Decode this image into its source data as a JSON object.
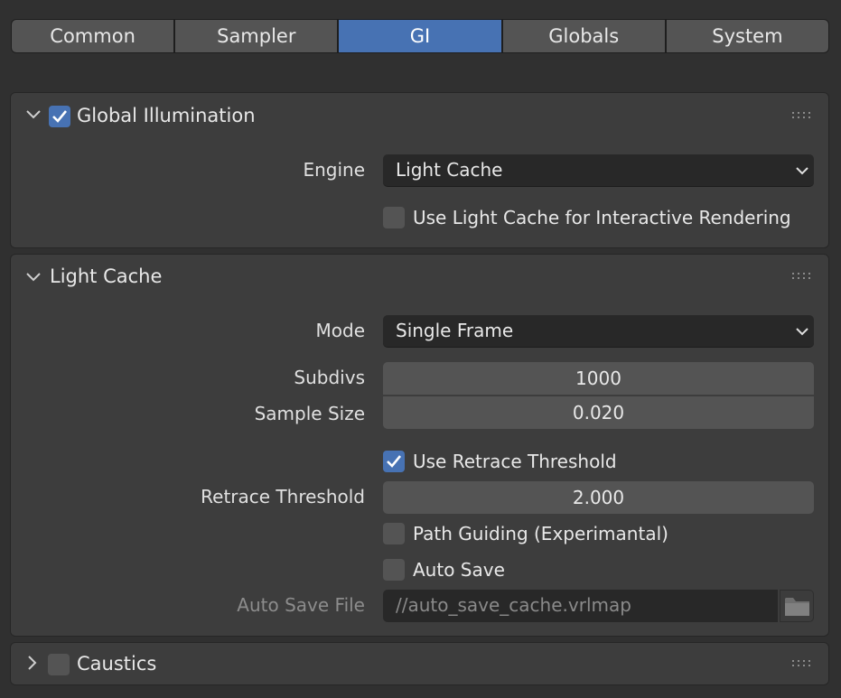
{
  "tabs": [
    {
      "label": "Common",
      "active": false
    },
    {
      "label": "Sampler",
      "active": false
    },
    {
      "label": "GI",
      "active": true
    },
    {
      "label": "Globals",
      "active": false
    },
    {
      "label": "System",
      "active": false
    }
  ],
  "gi_panel": {
    "title": "Global Illumination",
    "enabled": true,
    "expanded": true,
    "engine_label": "Engine",
    "engine_value": "Light Cache",
    "interactive_label": "Use Light Cache for Interactive Rendering",
    "interactive_checked": false
  },
  "light_cache_panel": {
    "title": "Light Cache",
    "expanded": true,
    "mode_label": "Mode",
    "mode_value": "Single Frame",
    "subdivs_label": "Subdivs",
    "subdivs_value": "1000",
    "sample_size_label": "Sample Size",
    "sample_size_value": "0.020",
    "use_retrace_label": "Use Retrace Threshold",
    "use_retrace_checked": true,
    "retrace_label": "Retrace Threshold",
    "retrace_value": "2.000",
    "path_guiding_label": "Path Guiding (Experimantal)",
    "path_guiding_checked": false,
    "auto_save_label": "Auto Save",
    "auto_save_checked": false,
    "auto_save_file_label": "Auto Save File",
    "auto_save_file_value": "//auto_save_cache.vrlmap"
  },
  "caustics_panel": {
    "title": "Caustics",
    "enabled": false,
    "expanded": false
  },
  "colors": {
    "background": "#303030",
    "panel": "#3d3d3d",
    "accent": "#4772b3",
    "field": "#545454",
    "dropdown": "#282828"
  },
  "icons": [
    "chevron-down-icon",
    "chevron-right-icon",
    "checkmark-icon",
    "drag-grip-icon",
    "dropdown-arrow-icon",
    "folder-icon"
  ]
}
